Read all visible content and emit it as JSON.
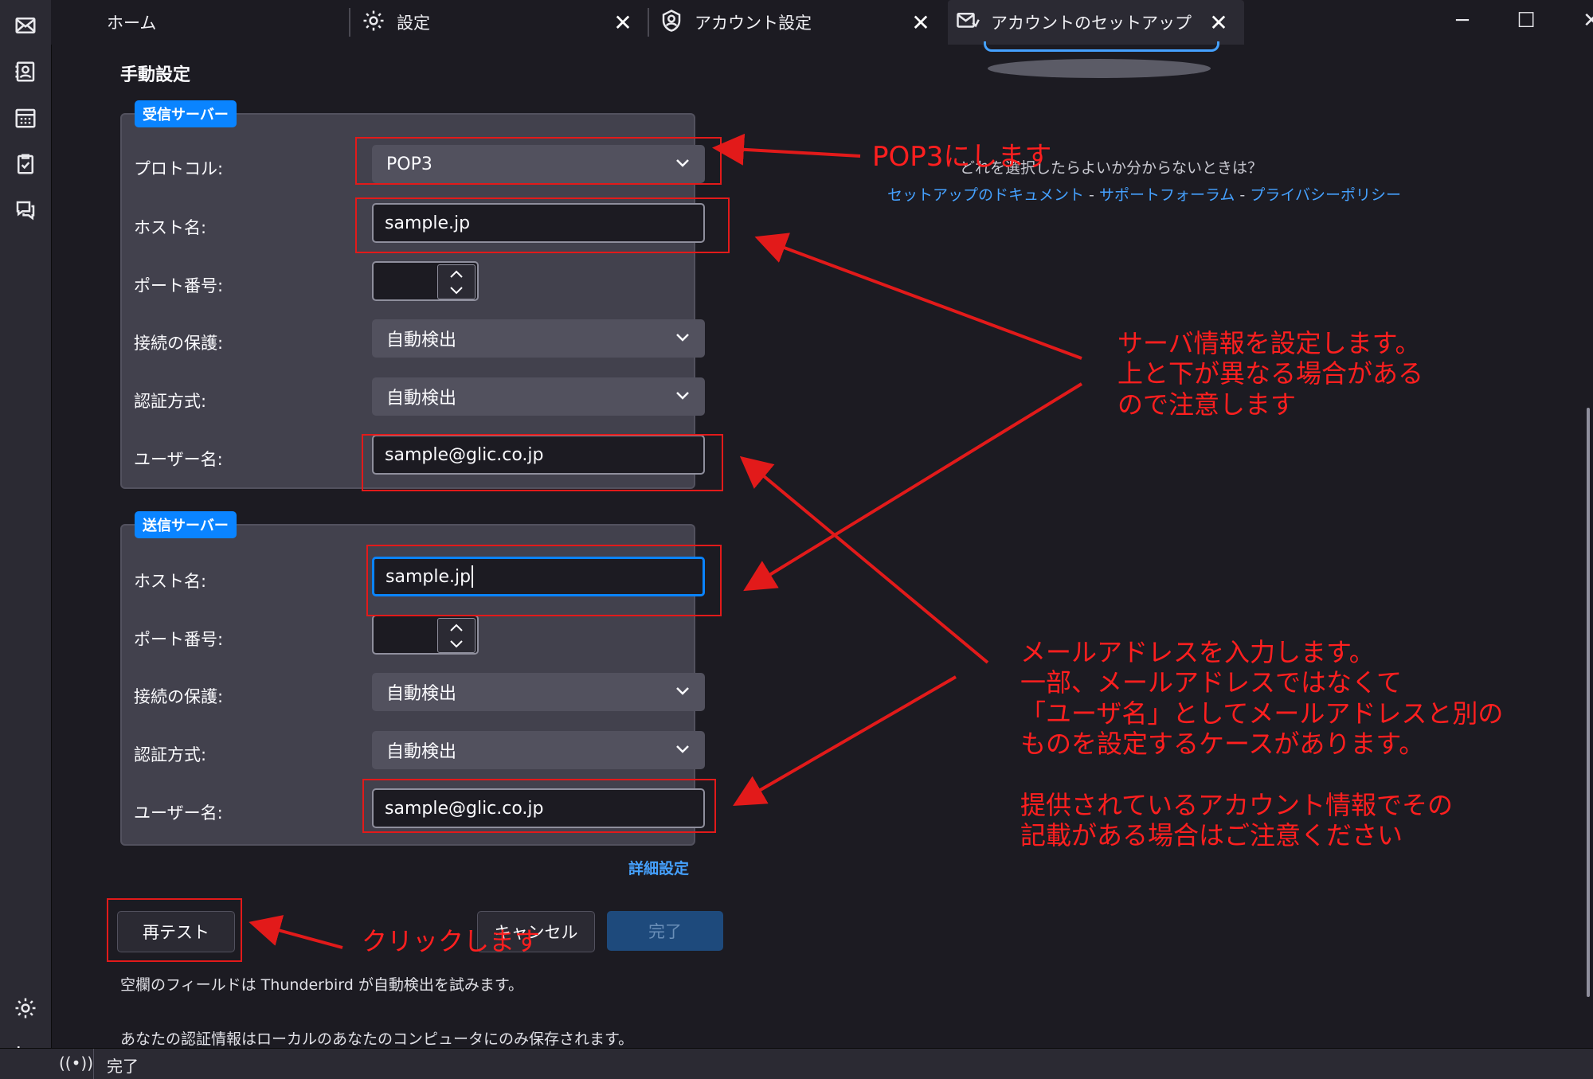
{
  "tabs": [
    {
      "label": "ホーム",
      "icon": "none"
    },
    {
      "label": "設定",
      "icon": "gear-icon"
    },
    {
      "label": "アカウント設定",
      "icon": "account-icon"
    },
    {
      "label": "アカウントのセットアップ",
      "icon": "mail-setup-icon"
    }
  ],
  "tab_close_glyph": "✕",
  "window_controls": {
    "minimize": "─",
    "maximize": "☐",
    "close": "✕"
  },
  "manual_config": {
    "title": "手動設定",
    "incoming": {
      "legend": "受信サーバー",
      "protocol_label": "プロトコル:",
      "protocol_value": "POP3",
      "hostname_label": "ホスト名:",
      "hostname_value": "sample.jp",
      "port_label": "ポート番号:",
      "port_value": "",
      "security_label": "接続の保護:",
      "security_value": "自動検出",
      "auth_label": "認証方式:",
      "auth_value": "自動検出",
      "username_label": "ユーザー名:",
      "username_value": "sample@glic.co.jp"
    },
    "outgoing": {
      "legend": "送信サーバー",
      "hostname_label": "ホスト名:",
      "hostname_value": "sample.jp",
      "port_label": "ポート番号:",
      "port_value": "",
      "security_label": "接続の保護:",
      "security_value": "自動検出",
      "auth_label": "認証方式:",
      "auth_value": "自動検出",
      "username_label": "ユーザー名:",
      "username_value": "sample@glic.co.jp"
    },
    "advanced_link": "詳細設定",
    "retest_button": "再テスト",
    "cancel_button": "キャンセル",
    "done_button": "完了",
    "note_autodetect": "空欄のフィールドは Thunderbird が自動検出を試みます。",
    "note_credentials": "あなたの認証情報はローカルのあなたのコンピュータにのみ保存されます。"
  },
  "help": {
    "question": "どれを選択したらよいか分からないときは？",
    "link_docs": "セットアップのドキュメント",
    "link_forum": "サポートフォーラム",
    "link_privacy": "プライバシーポリシー",
    "separator": " - "
  },
  "annotations": {
    "pop3": "POP3にします",
    "server": "サーバ情報を設定します。\n上と下が異なる場合がある\nので注意します",
    "mail": "メールアドレスを入力します。\n一部、メールアドレスではなくて\n「ユーザ名」としてメールアドレスと別の\nものを設定するケースがあります。\n\n提供されているアカウント情報でその\n記載がある場合はご注意ください",
    "click": "クリックします"
  },
  "statusbar": {
    "text": "完了",
    "icon": "broadcast-icon"
  },
  "colors": {
    "accent": "#0a84ff",
    "annotation": "#e21a1a",
    "background": "#1c1b22",
    "fieldset": "#42414d"
  }
}
